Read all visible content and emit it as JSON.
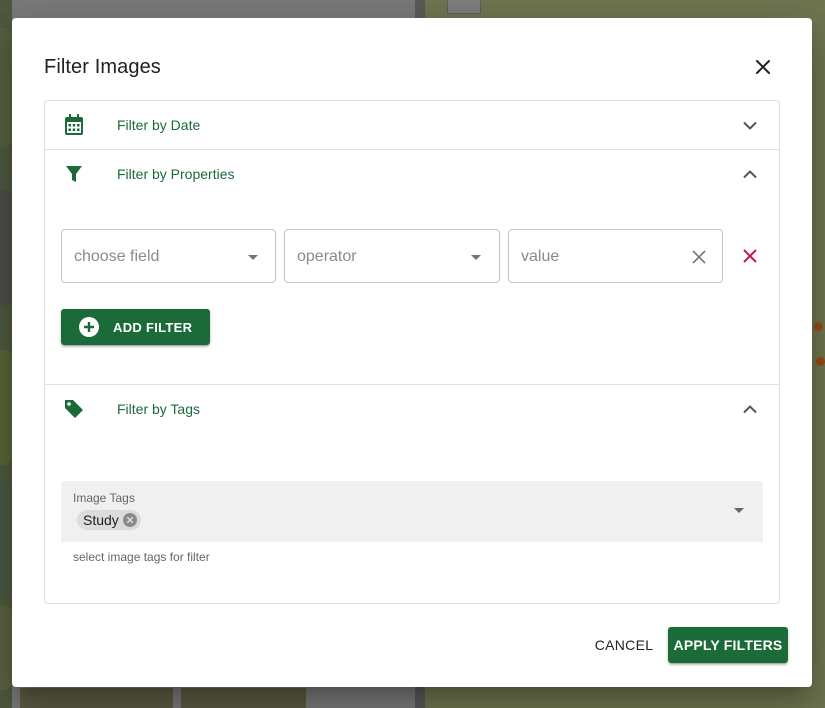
{
  "dialog": {
    "title": "Filter Images",
    "close_icon": "close-icon"
  },
  "panels": {
    "date": {
      "label": "Filter by Date",
      "icon": "calendar-icon",
      "expanded": false
    },
    "properties": {
      "label": "Filter by Properties",
      "icon": "filter-funnel-icon",
      "expanded": true,
      "field_placeholder": "choose field",
      "operator_placeholder": "operator",
      "value_placeholder": "value",
      "add_filter_label": "ADD FILTER"
    },
    "tags": {
      "label": "Filter by Tags",
      "icon": "tag-icon",
      "expanded": true,
      "field_label": "Image Tags",
      "selected_tags": [
        "Study"
      ],
      "hint": "select image tags for filter"
    }
  },
  "actions": {
    "cancel_label": "CANCEL",
    "apply_label": "APPLY FILTERS"
  },
  "colors": {
    "accent": "#1a6b37",
    "remove": "#c2185b",
    "label_green": "#1b6b3a"
  }
}
